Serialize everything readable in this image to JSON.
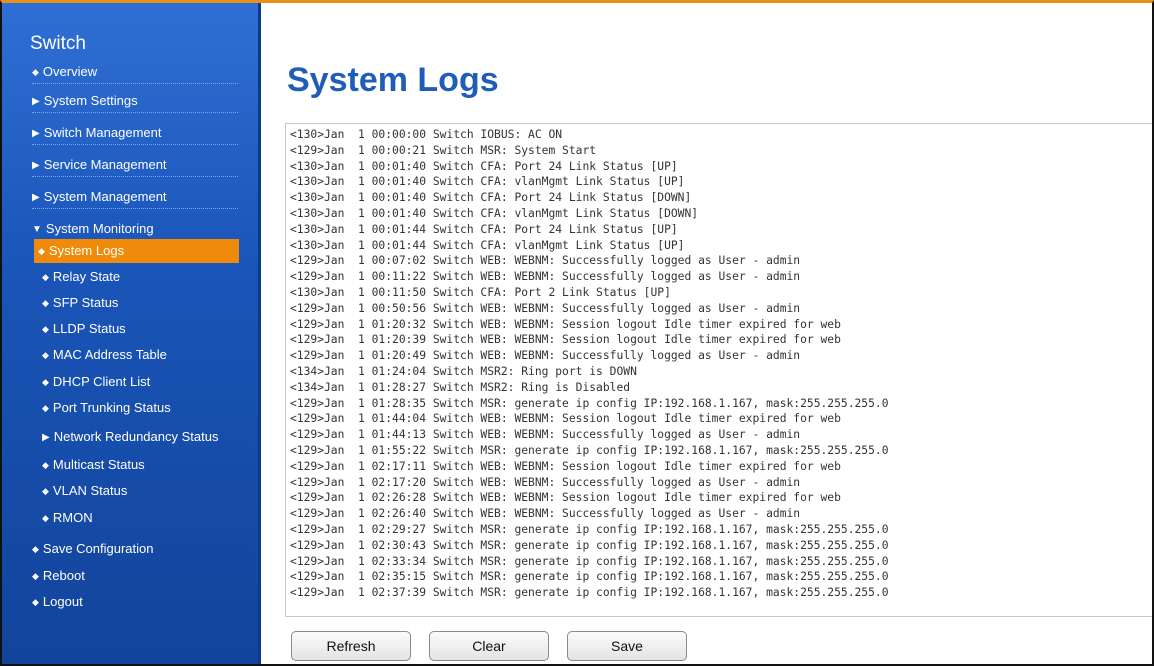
{
  "sidebar": {
    "brand": "Switch",
    "items": [
      {
        "label": "Overview"
      },
      {
        "label": "System Settings"
      },
      {
        "label": "Switch Management"
      },
      {
        "label": "Service Management"
      },
      {
        "label": "System Management"
      },
      {
        "label": "System Monitoring"
      },
      {
        "label": "System Logs"
      },
      {
        "label": "Relay State"
      },
      {
        "label": "SFP Status"
      },
      {
        "label": "LLDP Status"
      },
      {
        "label": "MAC Address Table"
      },
      {
        "label": "DHCP Client List"
      },
      {
        "label": "Port Trunking Status"
      },
      {
        "label": "Network Redundancy Status"
      },
      {
        "label": "Multicast Status"
      },
      {
        "label": "VLAN Status"
      },
      {
        "label": "RMON"
      },
      {
        "label": "Save Configuration"
      },
      {
        "label": "Reboot"
      },
      {
        "label": "Logout"
      }
    ],
    "active_color": "#f08a0b"
  },
  "main": {
    "title": "System Logs",
    "logs": [
      "<130>Jan  1 00:00:00 Switch IOBUS: AC ON",
      "<129>Jan  1 00:00:21 Switch MSR: System Start",
      "<130>Jan  1 00:01:40 Switch CFA: Port 24 Link Status [UP]",
      "<130>Jan  1 00:01:40 Switch CFA: vlanMgmt Link Status [UP]",
      "<130>Jan  1 00:01:40 Switch CFA: Port 24 Link Status [DOWN]",
      "<130>Jan  1 00:01:40 Switch CFA: vlanMgmt Link Status [DOWN]",
      "<130>Jan  1 00:01:44 Switch CFA: Port 24 Link Status [UP]",
      "<130>Jan  1 00:01:44 Switch CFA: vlanMgmt Link Status [UP]",
      "<129>Jan  1 00:07:02 Switch WEB: WEBNM: Successfully logged as User - admin",
      "<129>Jan  1 00:11:22 Switch WEB: WEBNM: Successfully logged as User - admin",
      "<130>Jan  1 00:11:50 Switch CFA: Port 2 Link Status [UP]",
      "<129>Jan  1 00:50:56 Switch WEB: WEBNM: Successfully logged as User - admin",
      "<129>Jan  1 01:20:32 Switch WEB: WEBNM: Session logout Idle timer expired for web",
      "<129>Jan  1 01:20:39 Switch WEB: WEBNM: Session logout Idle timer expired for web",
      "<129>Jan  1 01:20:49 Switch WEB: WEBNM: Successfully logged as User - admin",
      "<134>Jan  1 01:24:04 Switch MSR2: Ring port is DOWN",
      "<134>Jan  1 01:28:27 Switch MSR2: Ring is Disabled",
      "<129>Jan  1 01:28:35 Switch MSR: generate ip config IP:192.168.1.167, mask:255.255.255.0",
      "<129>Jan  1 01:44:04 Switch WEB: WEBNM: Session logout Idle timer expired for web",
      "<129>Jan  1 01:44:13 Switch WEB: WEBNM: Successfully logged as User - admin",
      "<129>Jan  1 01:55:22 Switch MSR: generate ip config IP:192.168.1.167, mask:255.255.255.0",
      "<129>Jan  1 02:17:11 Switch WEB: WEBNM: Session logout Idle timer expired for web",
      "<129>Jan  1 02:17:20 Switch WEB: WEBNM: Successfully logged as User - admin",
      "<129>Jan  1 02:26:28 Switch WEB: WEBNM: Session logout Idle timer expired for web",
      "<129>Jan  1 02:26:40 Switch WEB: WEBNM: Successfully logged as User - admin",
      "<129>Jan  1 02:29:27 Switch MSR: generate ip config IP:192.168.1.167, mask:255.255.255.0",
      "<129>Jan  1 02:30:43 Switch MSR: generate ip config IP:192.168.1.167, mask:255.255.255.0",
      "<129>Jan  1 02:33:34 Switch MSR: generate ip config IP:192.168.1.167, mask:255.255.255.0",
      "<129>Jan  1 02:35:15 Switch MSR: generate ip config IP:192.168.1.167, mask:255.255.255.0",
      "<129>Jan  1 02:37:39 Switch MSR: generate ip config IP:192.168.1.167, mask:255.255.255.0"
    ],
    "buttons": {
      "refresh": "Refresh",
      "clear": "Clear",
      "save": "Save"
    }
  }
}
